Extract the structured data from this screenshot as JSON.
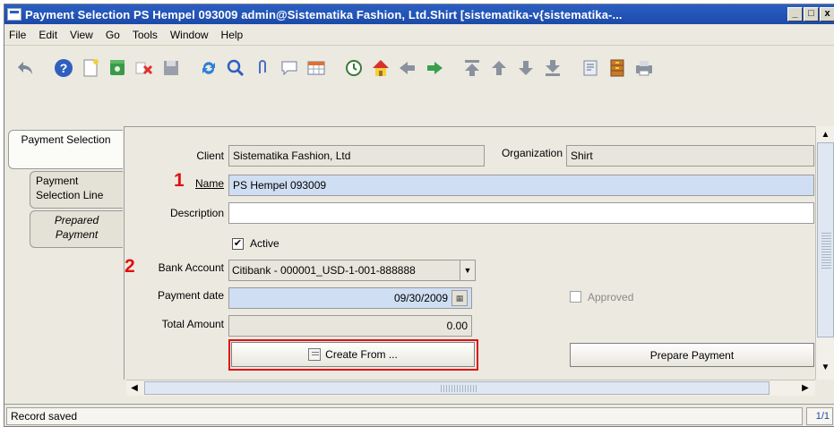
{
  "window": {
    "title": "Payment Selection  PS Hempel 093009  admin@Sistematika Fashion, Ltd.Shirt [sistematika-v{sistematika-...",
    "min_label": "_",
    "max_label": "□",
    "close_label": "x"
  },
  "menu": [
    "File",
    "Edit",
    "View",
    "Go",
    "Tools",
    "Window",
    "Help"
  ],
  "toolbar_icons": [
    "undo-icon",
    "help-icon",
    "new-record-icon",
    "copy-record-icon",
    "delete-icon",
    "save-icon",
    "refresh-icon",
    "find-icon",
    "attachment-icon",
    "chat-icon",
    "grid-toggle-icon",
    "history-icon",
    "home-icon",
    "back-icon",
    "forward-icon",
    "first-record-icon",
    "previous-record-icon",
    "next-record-icon",
    "last-record-icon",
    "report-icon",
    "archive-icon",
    "print-icon"
  ],
  "tabs": [
    {
      "label": "Payment Selection",
      "active": true
    },
    {
      "label": "Payment Selection Line",
      "active": false
    },
    {
      "label": "Prepared Payment",
      "active": false
    }
  ],
  "form": {
    "client_label": "Client",
    "client_value": "Sistematika Fashion, Ltd",
    "organization_label": "Organization",
    "organization_value": "Shirt",
    "name_label": "Name",
    "name_value": "PS Hempel 093009",
    "description_label": "Description",
    "description_value": "",
    "active_label": "Active",
    "active_checked": true,
    "bank_account_label": "Bank Account",
    "bank_account_value": "Citibank - 000001_USD-1-001-888888",
    "payment_date_label": "Payment date",
    "payment_date_value": "09/30/2009",
    "approved_label": "Approved",
    "approved_checked": false,
    "total_amount_label": "Total Amount",
    "total_amount_value": "0.00",
    "create_from_label": "Create From ...",
    "prepare_payment_label": "Prepare Payment"
  },
  "annotations": {
    "marker_1": "1",
    "marker_2": "2"
  },
  "status": {
    "message": "Record saved",
    "record_count": "1/1"
  }
}
